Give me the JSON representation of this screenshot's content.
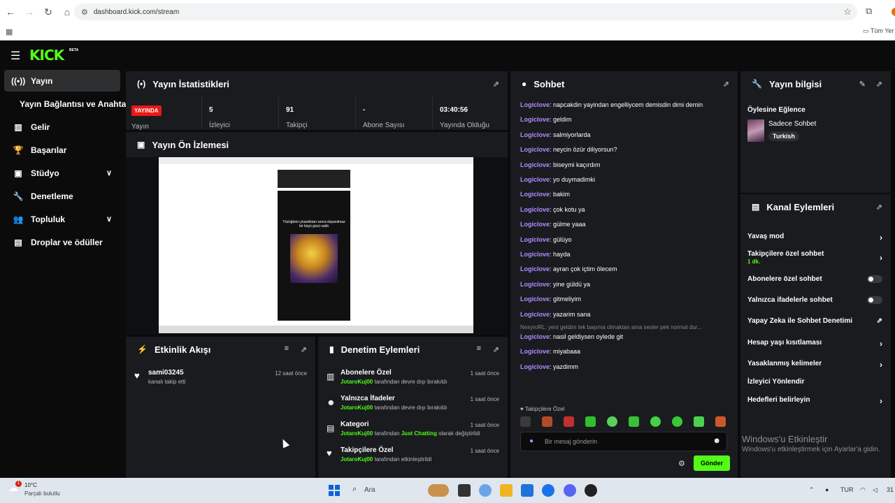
{
  "browser": {
    "url": "dashboard.kick.com/stream",
    "bookmarks_label": "Tüm Yer"
  },
  "app": {
    "logo": "KICK",
    "beta": "BETA"
  },
  "sidebar": {
    "items": [
      {
        "label": "Yayın"
      },
      {
        "label": "Yayın Bağlantısı ve Anahtarı"
      },
      {
        "label": "Gelir"
      },
      {
        "label": "Başarılar"
      },
      {
        "label": "Stüdyo"
      },
      {
        "label": "Denetleme"
      },
      {
        "label": "Topluluk"
      },
      {
        "label": "Droplar ve ödüller"
      }
    ]
  },
  "stats": {
    "title": "Yayın İstatistikleri",
    "live_badge": "YAYINDA",
    "status_label": "Yayın",
    "cells": [
      {
        "value": "5",
        "label": "İzleyici"
      },
      {
        "value": "91",
        "label": "Takipçi"
      },
      {
        "value": "-",
        "label": "Abone Sayısı"
      },
      {
        "value": "03:40:56",
        "label": "Yayında Olduğu"
      }
    ]
  },
  "preview": {
    "title": "Yayın Ön İzlemesi",
    "caption": "Yüzüğünü çıkardıktan sonra dayanılmaz bir büyü gücü saldı"
  },
  "activity": {
    "title": "Etkinlik Akışı",
    "items": [
      {
        "title": "sami03245",
        "sub": "kanalı takip etti",
        "time": "12 saat önce"
      }
    ]
  },
  "moderation": {
    "title": "Denetim Eylemleri",
    "items": [
      {
        "title": "Abonelere Özel",
        "user": "JotaroKuj00",
        "sub": "tarafından devre dışı bırakıldı",
        "time": "1 saat önce"
      },
      {
        "title": "Yalnızca İfadeler",
        "user": "JotaroKuj00",
        "sub": "tarafından devre dışı bırakıldı",
        "time": "1 saat önce"
      },
      {
        "title": "Kategori",
        "user": "JotaroKuj00",
        "sub_pre": "tarafından",
        "sub_hl": "Just Chatting",
        "sub_post": "olarak değiştirildi",
        "time": "1 saat önce"
      },
      {
        "title": "Takipçilere Özel",
        "user": "JotaroKuj00",
        "sub": "tarafından etkinleştirildi",
        "time": "1 saat önce"
      }
    ]
  },
  "chat": {
    "title": "Sohbet",
    "messages": [
      {
        "user": "Logiclove",
        "text": ": napcakdin yayindan engelliycem demisdin dimi demin"
      },
      {
        "user": "Logiclove",
        "text": ": geldim"
      },
      {
        "user": "Logiclove",
        "text": ": salmiyorlarda"
      },
      {
        "user": "Logiclove",
        "text": ": neycin özür diliyorsun?"
      },
      {
        "user": "Logiclove",
        "text": ": biseymi kaçırdım"
      },
      {
        "user": "Logiclove",
        "text": ": yo duymadimki"
      },
      {
        "user": "Logiclove",
        "text": ": bakim"
      },
      {
        "user": "Logiclove",
        "text": ": çok kotu ya"
      },
      {
        "user": "Logiclove",
        "text": ": gülme yaaa"
      },
      {
        "user": "Logiclove",
        "text": ": gülüyo"
      },
      {
        "user": "Logiclove",
        "text": ": hayda"
      },
      {
        "user": "Logiclove",
        "text": ": ayran çok içtim ölecem"
      },
      {
        "user": "Logiclove",
        "text": ": yine güldü ya"
      },
      {
        "user": "Logiclove",
        "text": ": gitmeliyim"
      },
      {
        "user": "Logiclove",
        "text": ": yazarim sana"
      }
    ],
    "system": "NexyroRL: yeni geldim tek başıma olmaktan ama sesler pek normal dur...",
    "messages2": [
      {
        "user": "Logiclove",
        "text": ": nasil geldiysen oylede git"
      },
      {
        "user": "Logiclove",
        "text": ": miyabaaa"
      },
      {
        "user": "Logiclove",
        "text": ": yazdimm"
      }
    ],
    "followers_only": "Takipçilere Özel",
    "input_placeholder": "Bir mesaj gönderin",
    "send_label": "Gönder"
  },
  "stream_info": {
    "title": "Yayın bilgisi",
    "stream_title": "Öylesine Eğlence",
    "category": "Sadece Sohbet",
    "tag": "Turkish"
  },
  "channel_actions": {
    "title": "Kanal Eylemleri",
    "items": [
      {
        "label": "Yavaş mod"
      },
      {
        "label": "Takipçilere özel sohbet",
        "extra": "1 dk."
      },
      {
        "label": "Abonelere özel sohbet"
      },
      {
        "label": "Yalnızca ifadelerle sohbet"
      },
      {
        "label": "Yapay Zeka ile Sohbet Denetimi"
      },
      {
        "label": "Hesap yaşı kısıtlaması"
      },
      {
        "label": "Yasaklanmış kelimeler"
      },
      {
        "label": "İzleyici Yönlendir"
      },
      {
        "label": "Hedefleri belirleyin"
      }
    ]
  },
  "watermark": {
    "title": "Windows'u Etkinleştir",
    "sub": "Windows'u etkinleştirmek için Ayarlar'a gidin."
  },
  "taskbar": {
    "temp": "10°C",
    "weather": "Parçalı bulutlu",
    "notif_count": "1",
    "search": "Ara",
    "lang": "TUR",
    "clock_partial": "31"
  },
  "colors": {
    "accent": "#53fc18",
    "live": "#e91916",
    "chat_user": "#b08cff",
    "panel": "#191b1f"
  }
}
